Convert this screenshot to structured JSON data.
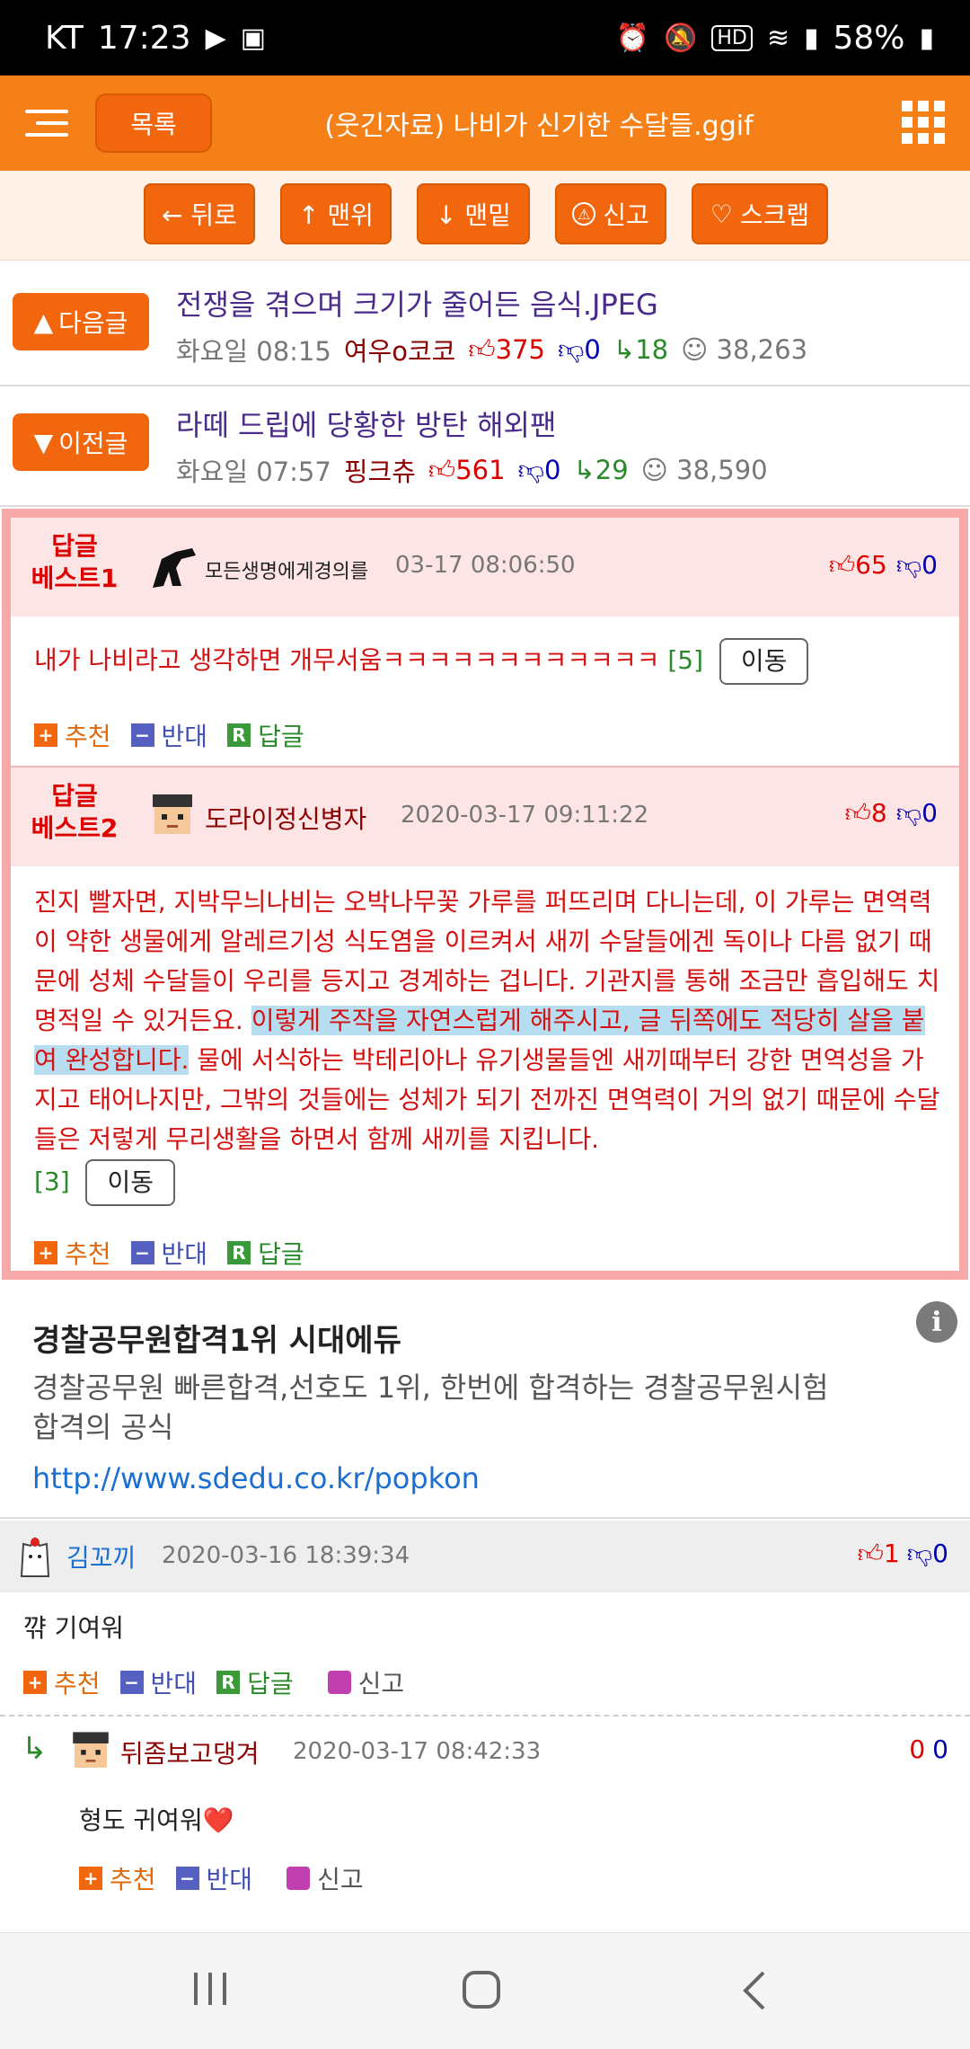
{
  "status": {
    "carrier": "KT",
    "time": "17:23",
    "battery": "58%"
  },
  "topbar": {
    "list_label": "목록",
    "title": "(웃긴자료) 나비가 신기한 수달들.ggif"
  },
  "nav_buttons": {
    "back": "← 뒤로",
    "top": "↑ 맨위",
    "bottom": "↓ 맨밑",
    "report": "신고",
    "scrap": "스크랩"
  },
  "next_post": {
    "button": "다음글",
    "title": "전쟁을 겪으며 크기가 줄어든 음식.JPEG",
    "day": "화요일 08:15",
    "author": "여우o코코",
    "up": "375",
    "down": "0",
    "replies": "18",
    "views": "38,263"
  },
  "prev_post": {
    "button": "이전글",
    "title": "라떼 드립에 당황한 방탄 해외팬",
    "day": "화요일 07:57",
    "author": "핑크츄",
    "up": "561",
    "down": "0",
    "replies": "29",
    "views": "38,590"
  },
  "best_replies": [
    {
      "label": "답글\n베스트1",
      "author": "모든생명에게경의를",
      "date": "03-17 08:06:50",
      "up": "65",
      "down": "0",
      "body": "내가 나비라고 생각하면 개무서움ㅋㅋㅋㅋㅋㅋㅋㅋㅋㅋㅋㅋ",
      "count": "[5]"
    },
    {
      "label": "답글\n베스트2",
      "author": "도라이정신병자",
      "date": "2020-03-17 09:11:22",
      "up": "8",
      "down": "0",
      "body_1": "진지 빨자면, 지박무늬나비는 오박나무꽃 가루를 퍼뜨리며 다니는데, 이 가루는 면역력이 약한 생물에게 알레르기성 식도염을 이르켜서 새끼 수달들에겐 독이나 다름 없기 때문에 성체 수달들이 우리를 등지고 경계하는 겁니다. 기관지를 통해 조금만 흡입해도 치명적일 수 있거든요. ",
      "body_highlight": "이렇게 주작을 자연스럽게 해주시고, 글 뒤쪽에도 적당히 살을 붙여 완성합니다.",
      "body_2": " 물에 서식하는 박테리아나 유기생물들엔 새끼때부터 강한 면역성을 가지고 태어나지만, 그밖의 것들에는 성체가 되기 전까진 면역력이 거의 없기 때문에 수달들은 저렇게 무리생활을 하면서 함께 새끼를 지킵니다.",
      "count": "[3]"
    }
  ],
  "common": {
    "move": "이동",
    "recommend": "추천",
    "oppose": "반대",
    "reply": "답글",
    "report": "신고"
  },
  "ad": {
    "title": "경찰공무원합격1위 시대에듀",
    "desc": "경찰공무원 빠른합격,선호도 1위, 한번에 합격하는 경찰공무원시험 합격의 공식",
    "url": "http://www.sdedu.co.kr/popkon"
  },
  "comments": [
    {
      "author": "김꼬끼",
      "date": "2020-03-16 18:39:34",
      "up": "1",
      "down": "0",
      "body": "꺆 기여워"
    },
    {
      "author": "뒤좀보고댕겨",
      "date": "2020-03-17 08:42:33",
      "up": "0",
      "down": "0",
      "body": "형도 귀여워❤️"
    }
  ],
  "colors": {
    "accent": "#f58018",
    "button": "#f2670e",
    "best_border": "#f7a8a8",
    "red_text": "#d51010"
  }
}
